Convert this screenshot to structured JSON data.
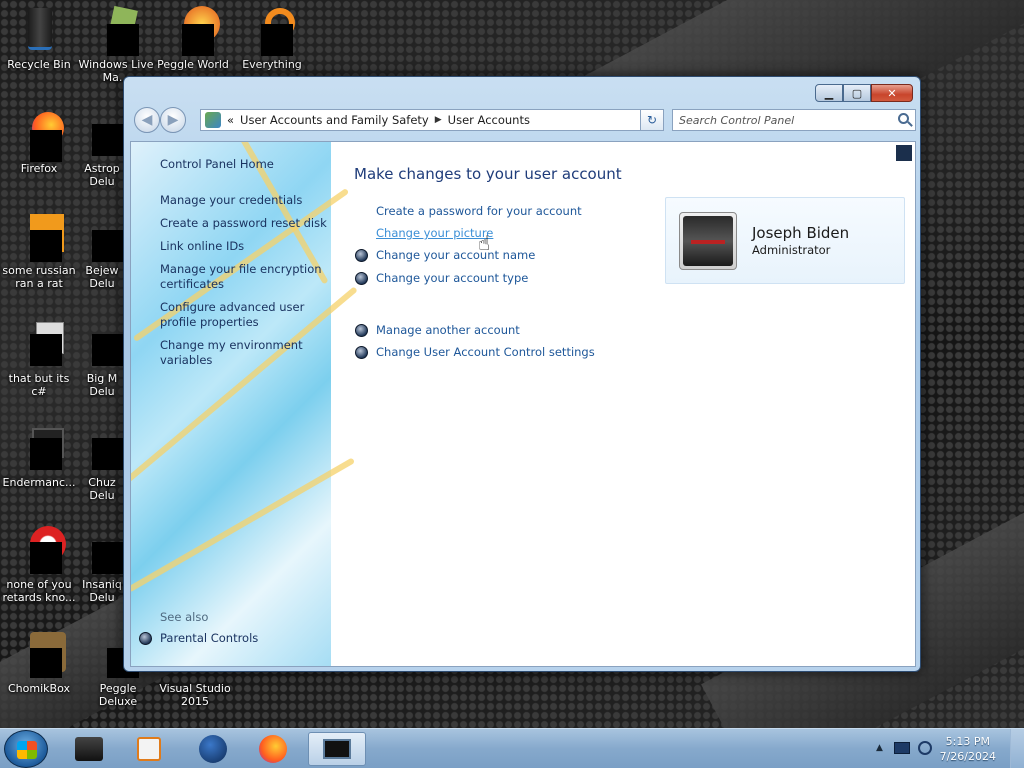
{
  "desktop": {
    "icons": [
      {
        "label": "Recycle Bin",
        "icon": "recycle-bin-icon"
      },
      {
        "label": "Windows Live Ma...",
        "icon": "windows-live-icon"
      },
      {
        "label": "Peggle World",
        "icon": "peggle-world-icon"
      },
      {
        "label": "Everything",
        "icon": "everything-search-icon"
      },
      {
        "label": "Firefox",
        "icon": "firefox-icon"
      },
      {
        "label": "Astrop Delu",
        "icon": "astropop-icon"
      },
      {
        "label": "some russian ran a rat",
        "icon": "app-icon"
      },
      {
        "label": "Bejew Delu",
        "icon": "bejeweled-icon"
      },
      {
        "label": "that but its c#",
        "icon": "document-icon"
      },
      {
        "label": "Big M Delu",
        "icon": "game-icon"
      },
      {
        "label": "Endermanc...",
        "icon": "app-window-icon"
      },
      {
        "label": "Chuz Delu",
        "icon": "game-icon"
      },
      {
        "label": "none of you retards kno...",
        "icon": "app-icon"
      },
      {
        "label": "Insaniq Delu",
        "icon": "game-icon"
      },
      {
        "label": "ChomikBox",
        "icon": "chomikbox-icon"
      },
      {
        "label": "Peggle Deluxe",
        "icon": "peggle-icon"
      },
      {
        "label": "Visual Studio 2015",
        "icon": "visual-studio-icon"
      }
    ]
  },
  "window": {
    "caption_buttons": {
      "minimize": "▁",
      "maximize": "▢",
      "close": "✕"
    },
    "breadcrumb": {
      "chevrons": "«",
      "items": [
        "User Accounts and Family Safety",
        "User Accounts"
      ],
      "separator": "▶"
    },
    "search_placeholder": "Search Control Panel",
    "left_nav": {
      "home": "Control Panel Home",
      "links": [
        "Manage your credentials",
        "Create a password reset disk",
        "Link online IDs",
        "Manage your file encryption certificates",
        "Configure advanced user profile properties",
        "Change my environment variables"
      ],
      "see_also_label": "See also",
      "see_also_links": [
        "Parental Controls"
      ]
    },
    "main": {
      "heading": "Make changes to your user account",
      "tasks": [
        "Create a password for your account",
        "Change your picture",
        "Change your account name",
        "Change your account type"
      ],
      "other_tasks": [
        "Manage another account",
        "Change User Account Control settings"
      ],
      "account": {
        "name": "Joseph Biden",
        "role": "Administrator"
      }
    }
  },
  "taskbar": {
    "items": [
      "game-icon",
      "media-player-icon",
      "globe-icon",
      "firefox-icon",
      "control-panel-icon"
    ],
    "active_index": 4,
    "clock": {
      "time": "5:13 PM",
      "date": "7/26/2024"
    }
  }
}
